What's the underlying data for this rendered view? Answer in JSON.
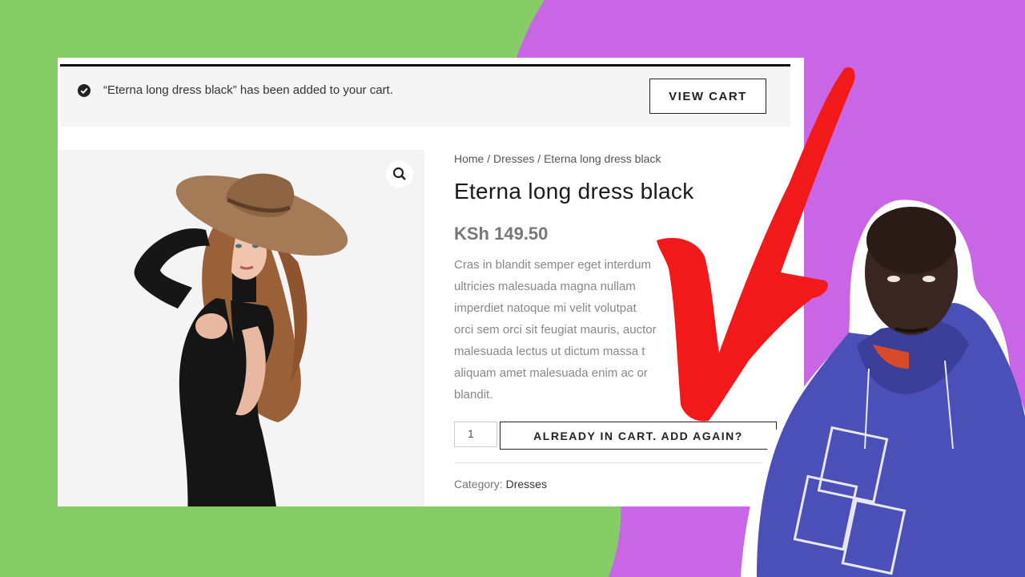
{
  "colors": {
    "green_bg": "#86cd68",
    "purple_bg": "#c966e6",
    "arrow_red": "#f2191b",
    "hoodie": "#4b4fb8"
  },
  "notice": {
    "icon": "check-circle-icon",
    "message": "“Eterna long dress black” has been added to your cart.",
    "view_cart_label": "VIEW CART"
  },
  "gallery": {
    "zoom_icon": "magnifier-icon",
    "image": "woman in black long dress with wide-brim straw hat"
  },
  "product": {
    "breadcrumb": [
      "Home",
      "Dresses",
      "Eterna long dress black"
    ],
    "breadcrumb_sep": " / ",
    "title": "Eterna long dress black",
    "price": "KSh 149.50",
    "description_lines": [
      "Cras in blandit semper eget interdum",
      "ultricies malesuada magna nullam",
      "imperdiet natoque mi velit volutpat",
      "orci sem orci sit feugiat mauris, auctor",
      "malesuada lectus ut dictum massa t",
      "aliquam amet malesuada enim ac or",
      "blandit."
    ],
    "quantity": "1",
    "add_button_label": "ALREADY IN CART. ADD AGAIN?",
    "category_label": "Category:",
    "category_value": "Dresses"
  },
  "overlay": {
    "arrow": "red-checkmark-arrow",
    "person": "man in blue hoodie cutout"
  }
}
